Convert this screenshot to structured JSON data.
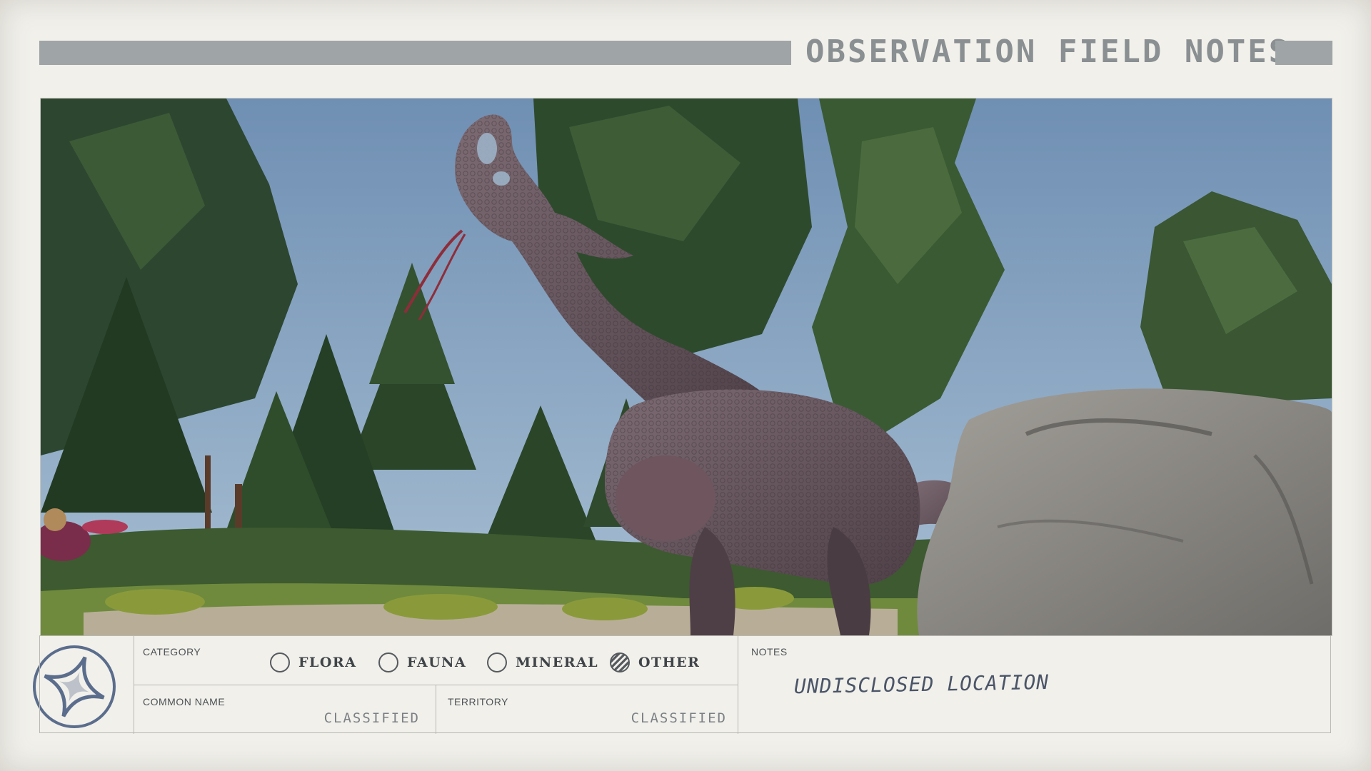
{
  "header": {
    "title": "OBSERVATION FIELD NOTES"
  },
  "colors": {
    "card": "#f1f0eb",
    "header_bar": "#9fa4a6",
    "sky": "#8aa9c7",
    "creature": "#6b5b63",
    "rock": "#8c8a86",
    "foliage": "#2f4a2a"
  },
  "emblem": {
    "icon": "star-compass-icon"
  },
  "category": {
    "label": "CATEGORY",
    "options": [
      {
        "label": "FLORA",
        "selected": false
      },
      {
        "label": "FAUNA",
        "selected": false
      },
      {
        "label": "MINERAL",
        "selected": false
      },
      {
        "label": "OTHER",
        "selected": true
      }
    ]
  },
  "common_name": {
    "label": "COMMON NAME",
    "value": "CLASSIFIED"
  },
  "territory": {
    "label": "TERRITORY",
    "value": "CLASSIFIED"
  },
  "notes": {
    "label": "NOTES",
    "value": "UNDISCLOSED LOCATION"
  }
}
